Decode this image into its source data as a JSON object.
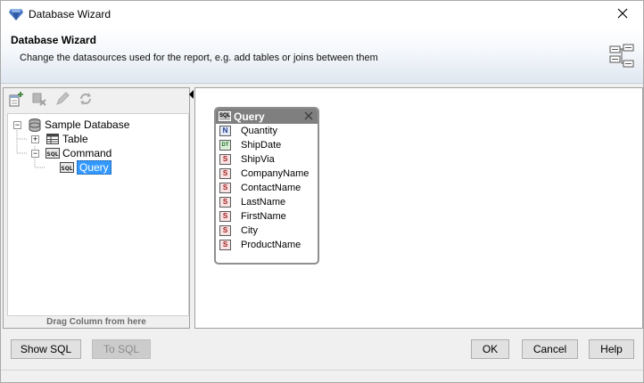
{
  "window": {
    "title": "Database Wizard"
  },
  "banner": {
    "heading": "Database Wizard",
    "description": "Change the datasources used for the report, e.g. add tables or joins between them"
  },
  "toolbar": {
    "buttons": [
      {
        "icon": "add-datasource-icon",
        "enabled": true
      },
      {
        "icon": "delete-icon",
        "enabled": false
      },
      {
        "icon": "edit-pencil-icon",
        "enabled": false
      },
      {
        "icon": "refresh-icon",
        "enabled": false
      }
    ]
  },
  "tree": {
    "root": "Sample Database",
    "children": [
      {
        "label": "Table",
        "expanded": false
      },
      {
        "label": "Command",
        "expanded": true,
        "children": [
          {
            "label": "Query",
            "selected": true
          }
        ]
      }
    ],
    "hint": "Drag Column from here"
  },
  "query_table": {
    "title": "Query",
    "fields": [
      {
        "type": "N",
        "name": "Quantity"
      },
      {
        "type": "DT",
        "name": "ShipDate"
      },
      {
        "type": "S",
        "name": "ShipVia"
      },
      {
        "type": "S",
        "name": "CompanyName"
      },
      {
        "type": "S",
        "name": "ContactName"
      },
      {
        "type": "S",
        "name": "LastName"
      },
      {
        "type": "S",
        "name": "FirstName"
      },
      {
        "type": "S",
        "name": "City"
      },
      {
        "type": "S",
        "name": "ProductName"
      }
    ]
  },
  "buttons": {
    "show_sql": "Show SQL",
    "to_sql": "To SQL",
    "ok": "OK",
    "cancel": "Cancel",
    "help": "Help"
  },
  "colors": {
    "selection": "#3399ff",
    "query_header": "#7f7f7f"
  }
}
